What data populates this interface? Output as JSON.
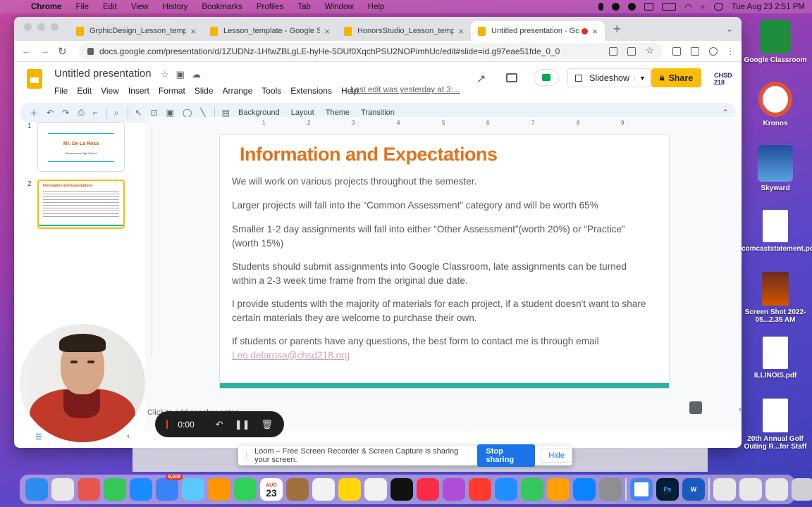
{
  "menubar": {
    "app": "Chrome",
    "items": [
      "File",
      "Edit",
      "View",
      "History",
      "Bookmarks",
      "Profiles",
      "Tab",
      "Window",
      "Help"
    ],
    "clock": "Tue Aug 23  2:51 PM"
  },
  "browser": {
    "tabs": [
      {
        "title": "GrphicDesign_Lesson_template"
      },
      {
        "title": "Lesson_template - Google Slid"
      },
      {
        "title": "HonorsStudio_Lesson_template"
      },
      {
        "title": "Untitled presentation - Goo"
      }
    ],
    "url": "docs.google.com/presentation/d/1ZUDNz-1HfwZBLgLE-hyHe-5DUf0XqchPSU2NOPimhUc/edit#slide=id.g97eae51fde_0_0"
  },
  "doc": {
    "title": "Untitled presentation",
    "menu": [
      "File",
      "Edit",
      "View",
      "Insert",
      "Format",
      "Slide",
      "Arrange",
      "Tools",
      "Extensions",
      "Help"
    ],
    "last_edit": "Last edit was yesterday at 3:...",
    "slideshow_label": "Slideshow",
    "share_label": "Share",
    "profile_text": "CHSD 218"
  },
  "toolbar": {
    "background": "Background",
    "layout": "Layout",
    "theme": "Theme",
    "transition": "Transition"
  },
  "ruler_marks": [
    "1",
    "2",
    "3",
    "4",
    "5",
    "6",
    "7",
    "8",
    "9"
  ],
  "filmstrip": {
    "slide1": {
      "num": "1",
      "title": "Mr. De La Rosa",
      "subtitle": "Streamwood High School"
    },
    "slide2": {
      "num": "2",
      "title": "Information and Expectations"
    }
  },
  "slide": {
    "title": "Information and Expectations",
    "p1": "We will work on various projects throughout the semester.",
    "p2": "Larger projects will fall into the “Common Assessment” category and will be worth 65%",
    "p3": "Smaller 1-2 day assignments will fall into either “Other Assessment”(worth 20%) or “Practice” (worth 15%)",
    "p4": "Students should submit assignments into Google Classroom, late assignments can be turned within a 2-3 week time frame from the original due date.",
    "p5": "I provide students with the majority of materials for each project, if a student doesn't want to share certain materials they are welcome to purchase their own.",
    "p6": "If students or parents have any questions, the best form to contact me is through email",
    "email": "Leo.delarosa@chsd218.org"
  },
  "loom": {
    "timer": "0:00",
    "tip": "Click to add speaker notes",
    "notice": "Loom – Free Screen Recorder & Screen Capture is sharing your screen.",
    "stop_sharing": "Stop sharing",
    "hide": "Hide"
  },
  "desktop": [
    {
      "label": "Google Classroom"
    },
    {
      "label": "Kronos"
    },
    {
      "label": "Skyward"
    },
    {
      "label": "comcaststatement.pdf"
    },
    {
      "label": "Screen Shot 2022-05...2.35 AM"
    },
    {
      "label": "ILLINOIS.pdf"
    },
    {
      "label": "20th Annual Golf Outing R...for Staff"
    }
  ],
  "dock": {
    "calendar_month": "AUG",
    "calendar_day": "23",
    "mail_badge": "9,509"
  },
  "colors": {
    "accent_yellow": "#fbbc04",
    "title_orange": "#e0741f",
    "teal_bar": "#2ab3a0"
  }
}
